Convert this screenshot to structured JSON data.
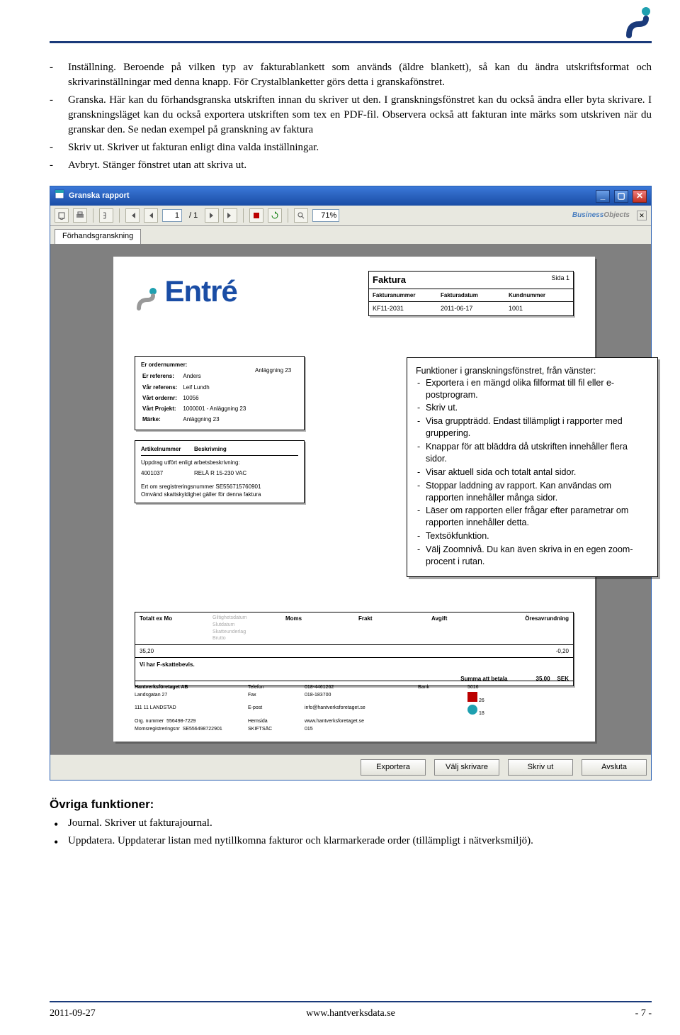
{
  "body_bullets": [
    "Inställning. Beroende på vilken typ av fakturablankett som används (äldre blankett), så kan du ändra utskriftsformat och skrivarinställningar med denna knapp. För Crystalblanketter görs detta i granskafönstret.",
    "Granska. Här kan du förhandsgranska utskriften innan du skriver ut den. I granskningsfönstret kan du också ändra eller byta skrivare. I granskningsläget kan du också exportera utskriften som tex en PDF-fil. Observera också att fakturan inte märks som utskriven när du granskar den. Se nedan exempel på granskning av faktura",
    "Skriv ut. Skriver ut fakturan enligt dina valda inställningar.",
    "Avbryt. Stänger fönstret utan att skriva ut."
  ],
  "window": {
    "title": "Granska rapport",
    "toolbar": {
      "page_current": "1",
      "page_total": "/ 1",
      "zoom": "71%"
    },
    "tab": "Förhandsgranskning",
    "businessobjects": "BusinessObjects",
    "bottom_buttons": [
      "Exportera",
      "Välj skrivare",
      "Skriv ut",
      "Avsluta"
    ]
  },
  "invoice": {
    "logo_text": "Entré",
    "header_title": "Faktura",
    "header_sida": "Sida 1",
    "head_cols": [
      "Fakturanummer",
      "Fakturadatum",
      "Kundnummer"
    ],
    "head_vals": [
      "KF11-2031",
      "2011-06-17",
      "1001"
    ],
    "anl_label": "Anläggning 23",
    "refs_title": "Er ordernummer:",
    "refs": [
      [
        "Er referens:",
        "Anders"
      ],
      [
        "Vår referens:",
        "Leif Lundh"
      ],
      [
        "Vårt ordernr:",
        "10056"
      ],
      [
        "Vårt Projekt:",
        "1000001 - Anläggning 23"
      ],
      [
        "Märke:",
        "Anläggning 23"
      ]
    ],
    "items_headers": [
      "Artikelnummer",
      "Beskrivning"
    ],
    "items_intro": "Uppdrag utfört enligt arbetsbeskrivning:",
    "items_row": [
      "4001037",
      "RELÄ R 15-230 VAC"
    ],
    "items_note1": "Ert om sregistreringsnummer SE556715760901",
    "items_note2": "Omvänd skattskyldighet gäller för denna faktura",
    "totals_cols": [
      "Totalt ex Mo",
      "",
      "Moms",
      "Frakt",
      "Avgift",
      "Öresavrundning"
    ],
    "totals_vals": [
      "35,20",
      "",
      "",
      "",
      "",
      "-0,20"
    ],
    "skattebevis": "Vi har F-skattebevis.",
    "sum_label": "Summa att betala",
    "sum_val": "35,00",
    "sum_cur": "SEK",
    "company": {
      "name": "Hantverksföretaget AB",
      "addr": "Landsgatan 27",
      "city": "111 11 LANDSTAD",
      "org_l": "Org. nummer",
      "org_v": "556498-7229",
      "moms_l": "Momsregistreringsnr",
      "moms_v": "SE556498722901",
      "tel_l": "Telefon",
      "tel_v": "018-4461262",
      "fax_l": "Fax",
      "fax_v": "018-183700",
      "epost_l": "E-post",
      "epost_v": "info@hantverksforetaget.se",
      "hem_l": "Hemsida",
      "hem_v": "www.hantverksforetaget.se",
      "skift_l": "SKIFTSÄC",
      "skift_v": "015",
      "bg_l": "Bank",
      "bg_v": "5016",
      "badges": [
        "26",
        "18"
      ]
    }
  },
  "callout": {
    "title": "Funktioner i granskningsfönstret, från vänster:",
    "items": [
      "Exportera i en mängd olika filformat till fil eller e-postprogram.",
      "Skriv ut.",
      "Visa gruppträdd. Endast tillämpligt i rapporter med gruppering.",
      "Knappar för att bläddra då utskriften innehåller flera sidor.",
      "Visar aktuell sida och totalt antal sidor.",
      "Stoppar laddning av rapport. Kan användas om rapporten innehåller många sidor.",
      "Läser om rapporten eller frågar efter parametrar om rapporten innehåller detta.",
      "Textsökfunktion.",
      "Välj Zoomnivå. Du kan även skriva in en egen zoom-procent i rutan."
    ]
  },
  "ovriga": {
    "heading": "Övriga funktioner:",
    "items": [
      "Journal. Skriver ut fakturajournal.",
      "Uppdatera. Uppdaterar listan med nytillkomna fakturor och klarmarkerade order (tillämpligt i nätverksmiljö)."
    ]
  },
  "footer": {
    "date": "2011-09-27",
    "url": "www.hantverksdata.se",
    "page": "- 7 -"
  }
}
